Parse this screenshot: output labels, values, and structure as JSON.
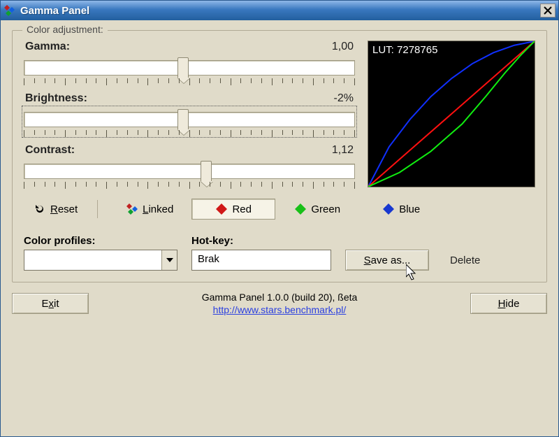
{
  "window": {
    "title": "Gamma Panel"
  },
  "group": {
    "title": "Color adjustment:"
  },
  "sliders": {
    "gamma": {
      "label": "Gamma:",
      "value": "1,00",
      "pos_pct": 48
    },
    "brightness": {
      "label": "Brightness:",
      "value": "-2%",
      "pos_pct": 48
    },
    "contrast": {
      "label": "Contrast:",
      "value": "1,12",
      "pos_pct": 55
    }
  },
  "lut": {
    "label": "LUT: 7278765"
  },
  "channels": {
    "reset": "Reset",
    "linked": "Linked",
    "red": "Red",
    "green": "Green",
    "blue": "Blue"
  },
  "profiles": {
    "label": "Color profiles:",
    "value": ""
  },
  "hotkey": {
    "label": "Hot-key:",
    "value": "Brak"
  },
  "buttons": {
    "save_as": "Save as...",
    "delete": "Delete",
    "exit": "Exit",
    "hide": "Hide"
  },
  "footer": {
    "line1": "Gamma Panel 1.0.0 (build 20), ßeta",
    "url": "http://www.stars.benchmark.pl/"
  },
  "chart_data": {
    "type": "line",
    "title": "LUT curves",
    "xlim": [
      0,
      255
    ],
    "ylim": [
      0,
      255
    ],
    "series": [
      {
        "name": "blue",
        "color": "#1030ff",
        "points": [
          [
            0,
            0
          ],
          [
            32,
            70
          ],
          [
            64,
            118
          ],
          [
            96,
            158
          ],
          [
            128,
            190
          ],
          [
            160,
            216
          ],
          [
            192,
            235
          ],
          [
            224,
            248
          ],
          [
            255,
            255
          ]
        ]
      },
      {
        "name": "red",
        "color": "#ff1010",
        "points": [
          [
            0,
            0
          ],
          [
            64,
            64
          ],
          [
            128,
            128
          ],
          [
            192,
            192
          ],
          [
            255,
            255
          ]
        ]
      },
      {
        "name": "green",
        "color": "#10ee10",
        "points": [
          [
            0,
            0
          ],
          [
            48,
            25
          ],
          [
            96,
            62
          ],
          [
            144,
            110
          ],
          [
            180,
            158
          ],
          [
            210,
            200
          ],
          [
            235,
            232
          ],
          [
            255,
            255
          ]
        ]
      }
    ]
  }
}
